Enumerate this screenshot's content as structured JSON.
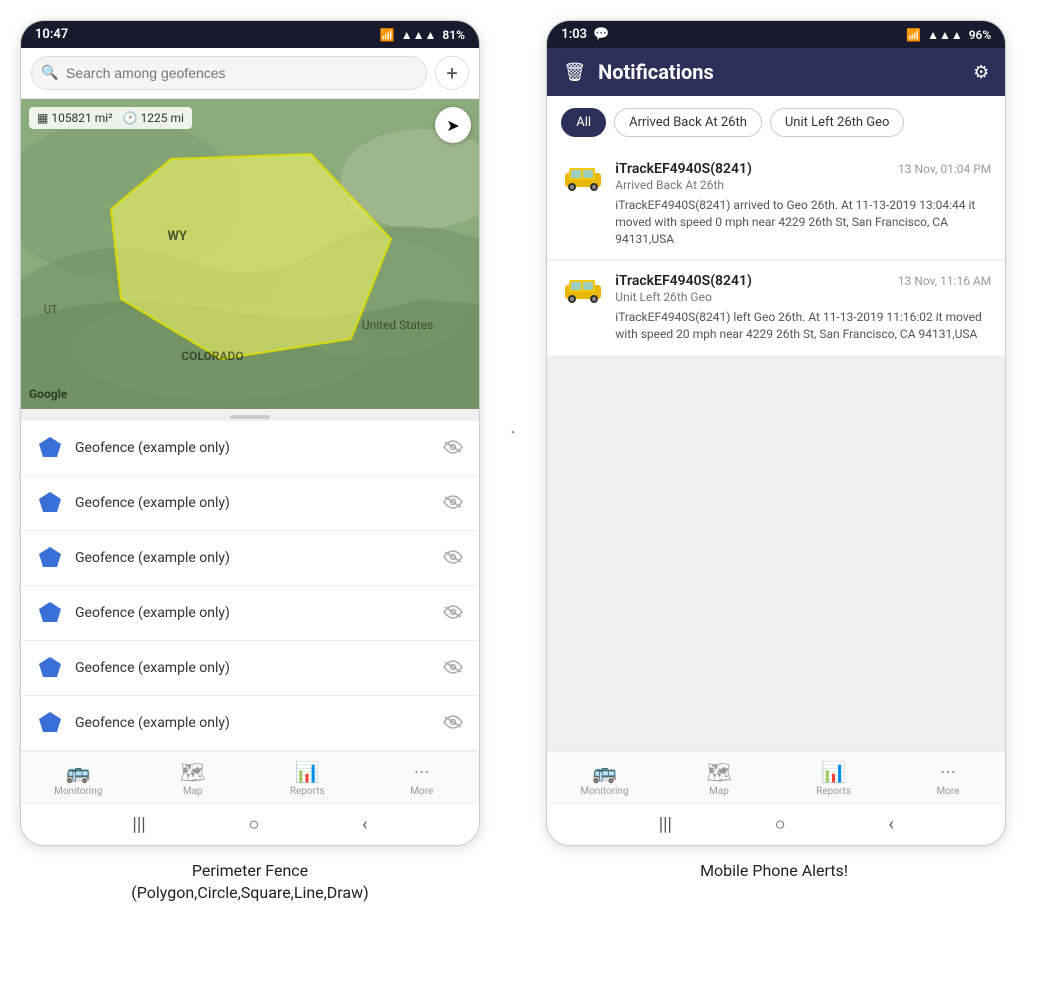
{
  "left_phone": {
    "status_bar": {
      "time": "10:47",
      "wifi": "WiFi",
      "signal": "4G",
      "battery": "81%"
    },
    "search": {
      "placeholder": "Search among geofences"
    },
    "map": {
      "stats": {
        "area": "105821 mi²",
        "distance": "1225 mi"
      },
      "labels": {
        "state_wy": "WY",
        "country": "United States",
        "state_colorado": "COLORADO",
        "state_ut": "UT"
      },
      "google": "Google"
    },
    "geofences": [
      {
        "name": "Geofence (example only)"
      },
      {
        "name": "Geofence (example only)"
      },
      {
        "name": "Geofence (example only)"
      },
      {
        "name": "Geofence (example only)"
      },
      {
        "name": "Geofence (example only)"
      },
      {
        "name": "Geofence (example only)"
      }
    ],
    "nav": [
      {
        "icon": "🚌",
        "label": "Monitoring"
      },
      {
        "icon": "🗺",
        "label": "Map"
      },
      {
        "icon": "📊",
        "label": "Reports"
      },
      {
        "icon": "···",
        "label": "More"
      }
    ],
    "android_nav": [
      "|||",
      "○",
      "<"
    ]
  },
  "right_phone": {
    "status_bar": {
      "time": "1:03",
      "chat": "💬",
      "wifi": "WiFi",
      "signal": "4G",
      "battery": "96%"
    },
    "header": {
      "title": "Notifications",
      "delete_icon": "🗑",
      "settings_icon": "⚙"
    },
    "filters": [
      {
        "label": "All",
        "active": true
      },
      {
        "label": "Arrived Back At 26th",
        "active": false
      },
      {
        "label": "Unit Left 26th Geo",
        "active": false
      }
    ],
    "notifications": [
      {
        "device": "iTrackEF4940S(8241)",
        "time": "13 Nov, 01:04 PM",
        "event": "Arrived Back At 26th",
        "body": "iTrackEF4940S(8241) arrived to Geo 26th.   At 11-13-2019 13:04:44 it moved with speed 0 mph near 4229 26th St, San Francisco, CA 94131,USA"
      },
      {
        "device": "iTrackEF4940S(8241)",
        "time": "13 Nov, 11:16 AM",
        "event": "Unit Left 26th Geo",
        "body": "iTrackEF4940S(8241) left Geo 26th.   At 11-13-2019 11:16:02 it moved with speed 20 mph near 4229 26th St, San Francisco, CA 94131,USA"
      }
    ],
    "nav": [
      {
        "icon": "🚌",
        "label": "Monitoring"
      },
      {
        "icon": "🗺",
        "label": "Map"
      },
      {
        "icon": "📊",
        "label": "Reports"
      },
      {
        "icon": "···",
        "label": "More"
      }
    ],
    "android_nav": [
      "|||",
      "○",
      "<"
    ]
  },
  "captions": {
    "left": "Perimeter Fence\n(Polygon,Circle,Square,Line,Draw)",
    "right": "Mobile Phone Alerts!"
  }
}
